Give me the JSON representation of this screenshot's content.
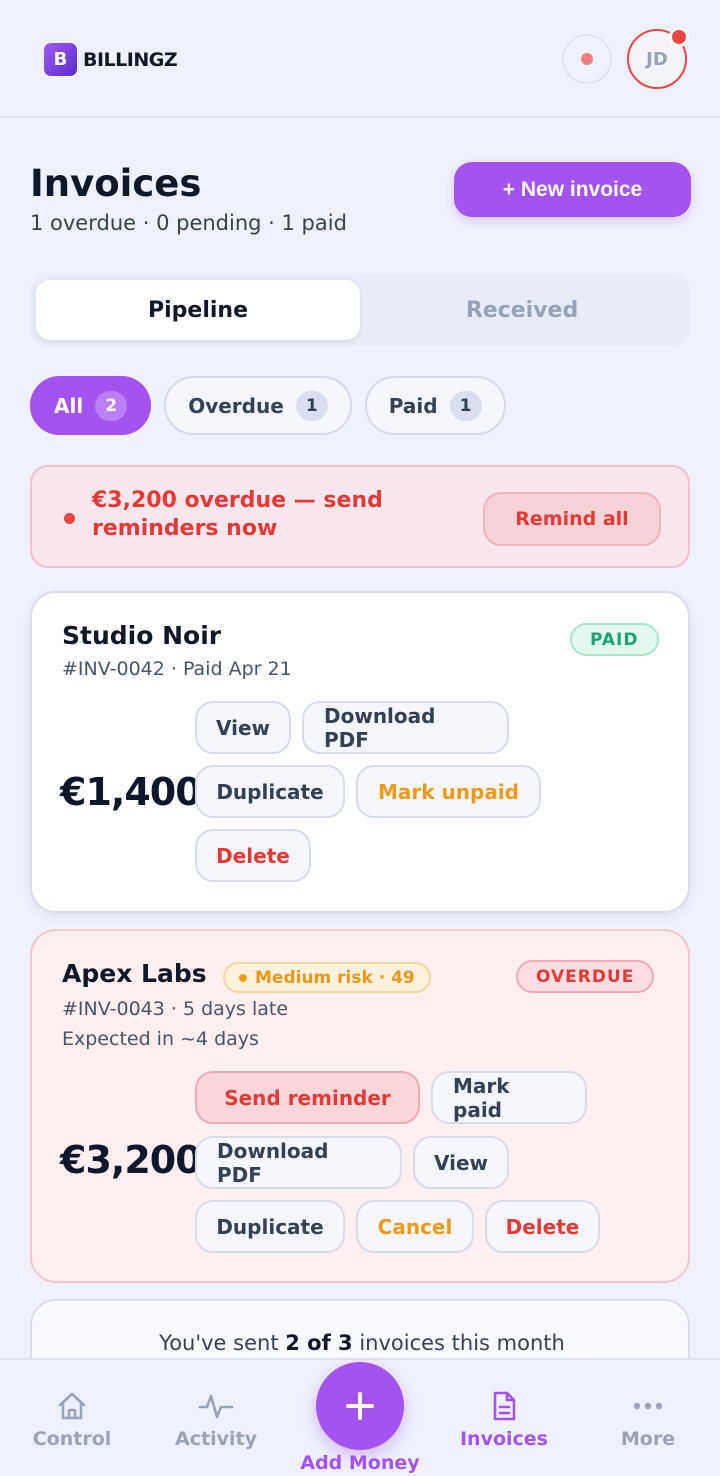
{
  "header": {
    "brand_letter": "B",
    "brand_name": "BILLINGZ",
    "avatar_initials": "JD"
  },
  "page": {
    "title": "Invoices",
    "subtitle": "1 overdue · 0 pending · 1 paid",
    "new_button": "+ New invoice"
  },
  "tabs": [
    {
      "label": "Pipeline",
      "active": true
    },
    {
      "label": "Received",
      "active": false
    }
  ],
  "filters": [
    {
      "label": "All",
      "count": "2",
      "active": true
    },
    {
      "label": "Overdue",
      "count": "1",
      "active": false
    },
    {
      "label": "Paid",
      "count": "1",
      "active": false
    }
  ],
  "alert": {
    "text": "€3,200 overdue — send reminders now",
    "button": "Remind all"
  },
  "invoices": [
    {
      "client": "Studio Noir",
      "meta": "#INV-0042 · Paid Apr 21",
      "status": "PAID",
      "amount": "€1,400",
      "actions": {
        "view": "View",
        "download": "Download PDF",
        "duplicate": "Duplicate",
        "mark_unpaid": "Mark unpaid",
        "delete": "Delete"
      }
    },
    {
      "client": "Apex Labs",
      "risk": "Medium risk · 49",
      "meta": "#INV-0043 · 5 days late",
      "expected": "Expected in ~4 days",
      "status": "OVERDUE",
      "amount": "€3,200",
      "actions": {
        "send_reminder": "Send reminder",
        "mark_paid": "Mark paid",
        "download": "Download PDF",
        "view": "View",
        "duplicate": "Duplicate",
        "cancel": "Cancel",
        "delete": "Delete"
      }
    }
  ],
  "usage": {
    "prefix": "You've sent ",
    "count": "2 of 3",
    "suffix": " invoices this month"
  },
  "nav": {
    "control": "Control",
    "activity": "Activity",
    "add_money": "Add Money",
    "invoices": "Invoices",
    "more": "More"
  },
  "colors": {
    "accent": "#a452f0",
    "danger": "#e53935",
    "success": "#17a673",
    "warning": "#ee9a16"
  }
}
